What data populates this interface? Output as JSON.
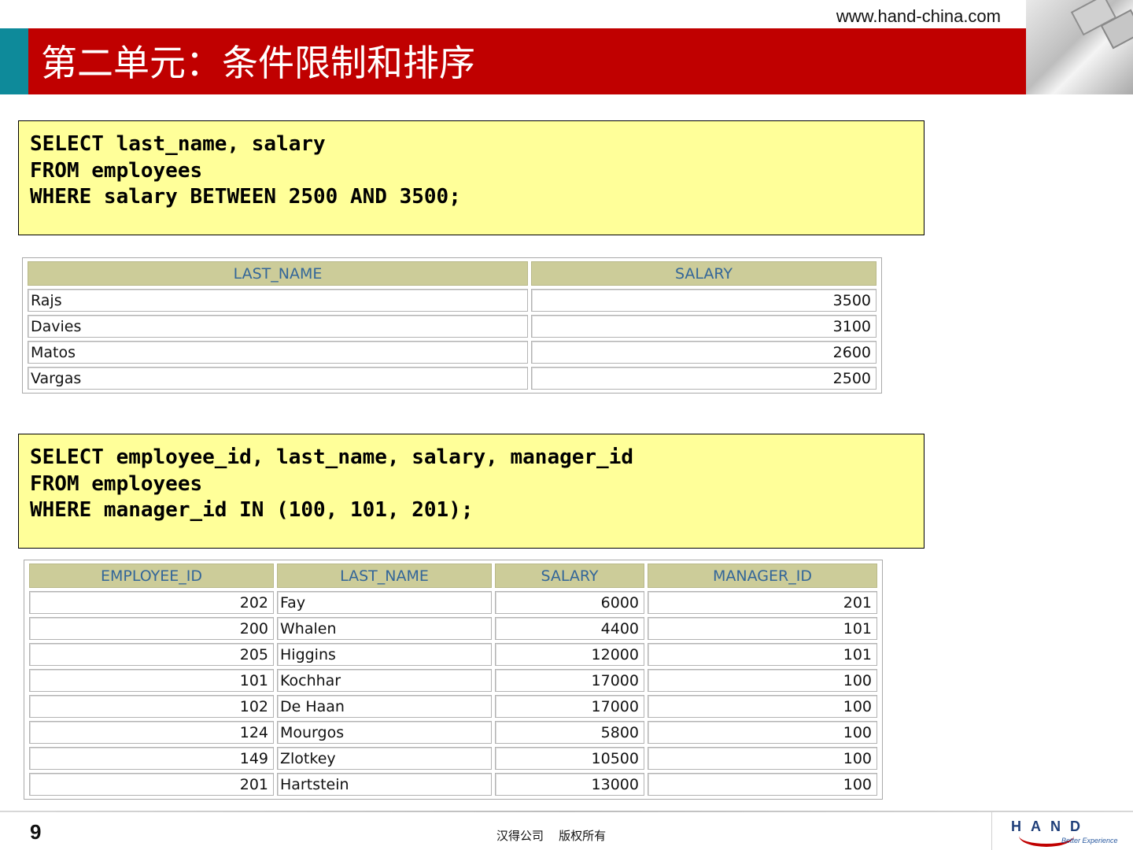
{
  "header": {
    "site_url": "www.hand-china.com",
    "title": "第二单元：条件限制和排序",
    "colors": {
      "title_bar": "#c00000",
      "accent": "#0e8a9a"
    }
  },
  "query1": {
    "lines": [
      "SELECT last_name, salary",
      "FROM employees",
      "WHERE salary BETWEEN 2500 AND 3500;"
    ]
  },
  "table1": {
    "columns": [
      "LAST_NAME",
      "SALARY"
    ],
    "rows": [
      [
        "Rajs",
        "3500"
      ],
      [
        "Davies",
        "3100"
      ],
      [
        "Matos",
        "2600"
      ],
      [
        "Vargas",
        "2500"
      ]
    ]
  },
  "query2": {
    "lines": [
      "SELECT employee_id, last_name, salary, manager_id",
      "FROM employees",
      "WHERE manager_id IN (100, 101, 201);"
    ]
  },
  "table2": {
    "columns": [
      "EMPLOYEE_ID",
      "LAST_NAME",
      "SALARY",
      "MANAGER_ID"
    ],
    "rows": [
      [
        "202",
        "Fay",
        "6000",
        "201"
      ],
      [
        "200",
        "Whalen",
        "4400",
        "101"
      ],
      [
        "205",
        "Higgins",
        "12000",
        "101"
      ],
      [
        "101",
        "Kochhar",
        "17000",
        "100"
      ],
      [
        "102",
        "De Haan",
        "17000",
        "100"
      ],
      [
        "124",
        "Mourgos",
        "5800",
        "100"
      ],
      [
        "149",
        "Zlotkey",
        "10500",
        "100"
      ],
      [
        "201",
        "Hartstein",
        "13000",
        "100"
      ]
    ]
  },
  "footer": {
    "page_number": "9",
    "copyright": "汉得公司    版权所有",
    "logo_text": "HAND",
    "logo_tagline": "Better Experience"
  }
}
